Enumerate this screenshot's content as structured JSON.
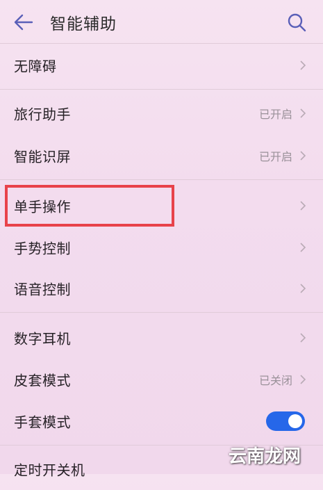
{
  "header": {
    "back_icon": "arrow-left-icon",
    "title": "智能辅助",
    "search_icon": "search-icon"
  },
  "items": [
    {
      "label": "无障碍",
      "status": ""
    },
    {
      "label": "旅行助手",
      "status": "已开启"
    },
    {
      "label": "智能识屏",
      "status": "已开启"
    },
    {
      "label": "单手操作",
      "status": ""
    },
    {
      "label": "手势控制",
      "status": ""
    },
    {
      "label": "语音控制",
      "status": ""
    },
    {
      "label": "数字耳机",
      "status": ""
    },
    {
      "label": "皮套模式",
      "status": "已关闭"
    },
    {
      "label": "手套模式",
      "status": "",
      "toggle": "on"
    },
    {
      "label": "定时开关机",
      "status": ""
    }
  ],
  "highlight_target": "单手操作",
  "colors": {
    "accent": "#2667e9",
    "highlight_border": "#e8424a",
    "icon": "#5a5fb8"
  },
  "watermark": "云南龙网"
}
